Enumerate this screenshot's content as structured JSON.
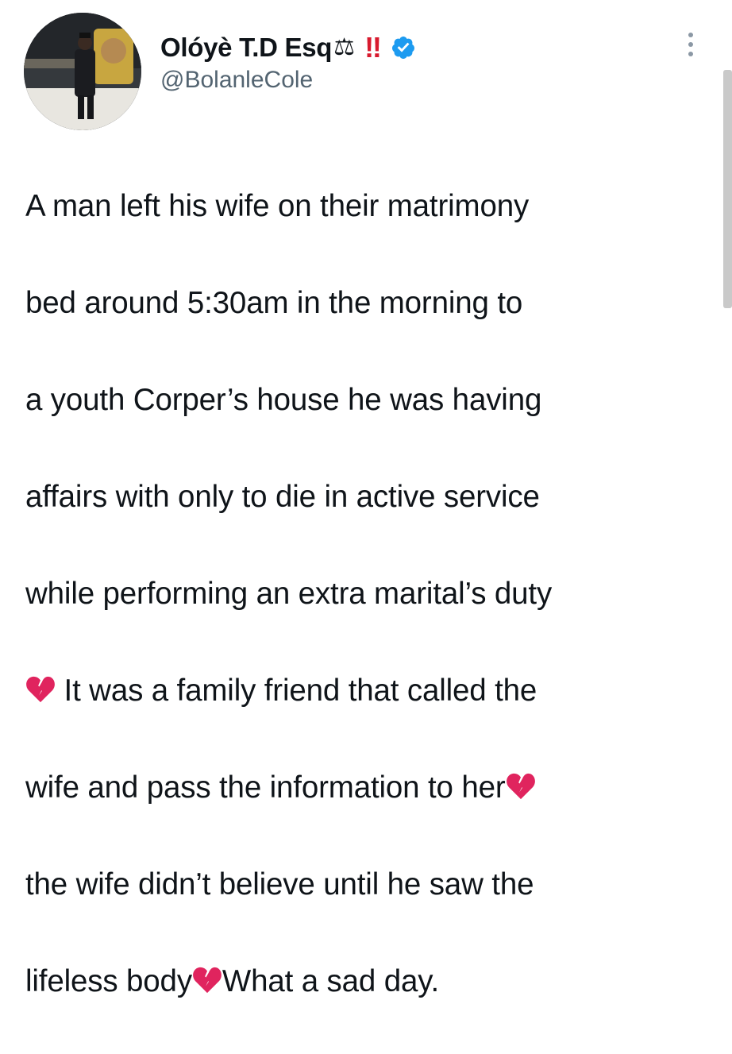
{
  "tweet": {
    "display_name": "Olóyè T.D Esq",
    "name_emoji": "⚖",
    "name_mark": "‼",
    "handle": "@BolanleCole",
    "verified": true,
    "text_lines": [
      "A man left his wife on their matrimony",
      "bed around 5:30am in the morning to",
      "a youth Corper’s house he was having",
      "affairs with only to die in active service",
      "while performing an extra marital’s duty",
      " It was a family friend that called the",
      "wife and pass the information to her",
      "the wife didn’t believe until he saw the",
      "lifeless body",
      "What a sad day."
    ]
  },
  "icons": {
    "avatar": "profile-photo",
    "scales": "scales-emoji",
    "bangbang": "double-exclamation-emoji",
    "verified": "verified-badge-icon",
    "more": "more-options-icon",
    "heart": "broken-heart-emoji"
  },
  "colors": {
    "text": "#0f1419",
    "secondary": "#536471",
    "verified": "#1d9bf0",
    "exclamation": "#d81a2e",
    "broken_heart": "#e0245e"
  }
}
